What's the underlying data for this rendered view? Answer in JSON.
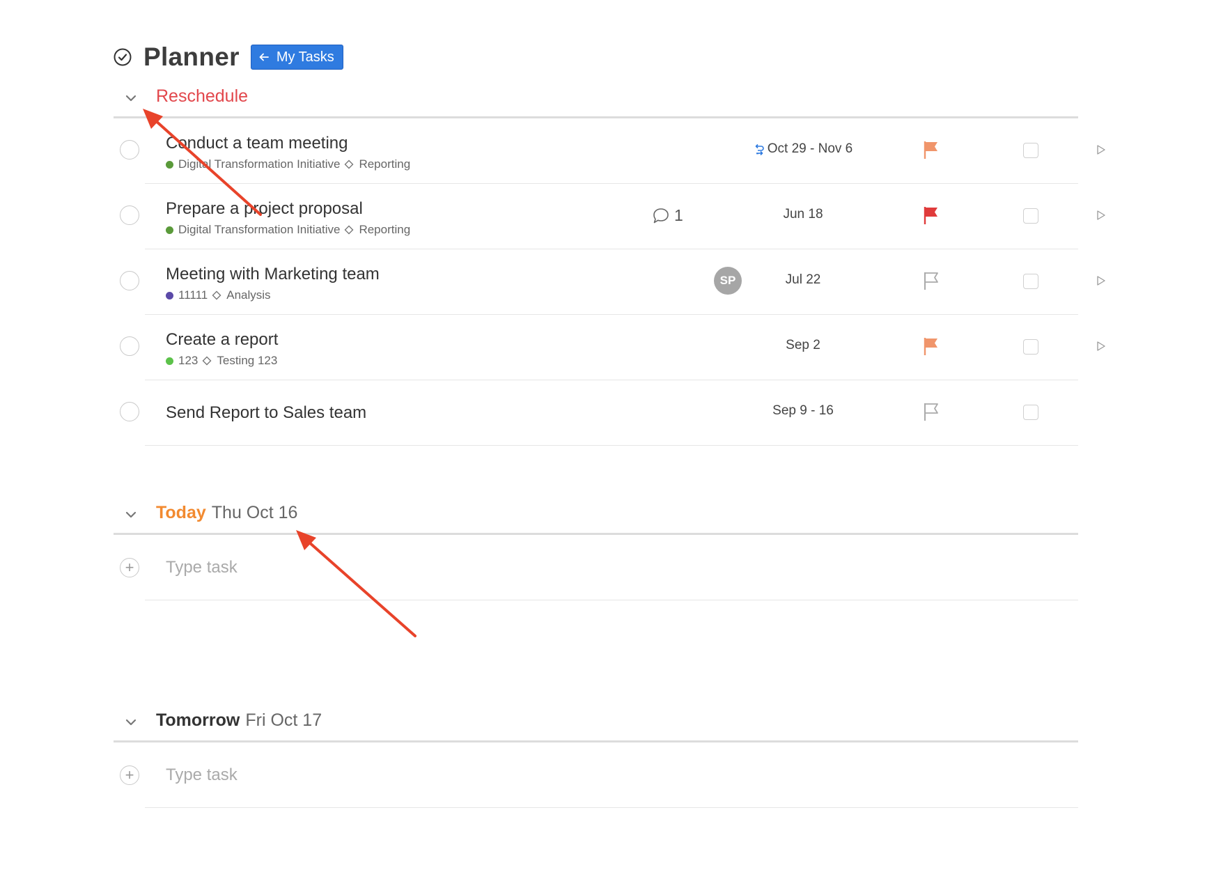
{
  "header": {
    "title": "Planner",
    "my_tasks_label": "My Tasks"
  },
  "colors": {
    "accent_blue": "#2f7be0",
    "reschedule_red": "#e2474c",
    "today_orange": "#f28a30",
    "flag_orange": "#f0956b",
    "flag_red": "#e03b3b",
    "annotation_red": "#e8432a"
  },
  "sections": {
    "reschedule": {
      "title": "Reschedule",
      "tasks": [
        {
          "title": "Conduct a team meeting",
          "project": "Digital Transformation Initiative",
          "project_color": "#5a9a3a",
          "tag": "Reporting",
          "date": "Oct 29 - Nov 6",
          "recurring": true,
          "flag": "orange"
        },
        {
          "title": "Prepare a project proposal",
          "project": "Digital Transformation Initiative",
          "project_color": "#5a9a3a",
          "tag": "Reporting",
          "comments": "1",
          "date": "Jun 18",
          "flag": "red"
        },
        {
          "title": "Meeting with Marketing team",
          "project": "11111",
          "project_color": "#5b4aa8",
          "tag": "Analysis",
          "assignee": "SP",
          "date": "Jul 22",
          "flag": "none"
        },
        {
          "title": "Create a report",
          "project": "123",
          "project_color": "#5cc24a",
          "tag": "Testing 123",
          "date": "Sep 2",
          "flag": "orange"
        },
        {
          "title": "Send Report to Sales team",
          "date": "Sep 9 - 16",
          "flag": "none"
        }
      ]
    },
    "today": {
      "title": "Today",
      "date": "Thu Oct 16",
      "placeholder": "Type task"
    },
    "tomorrow": {
      "title": "Tomorrow",
      "date": "Fri Oct 17",
      "placeholder": "Type task"
    }
  }
}
